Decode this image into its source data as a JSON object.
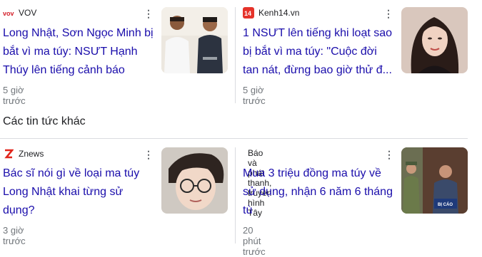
{
  "cards": [
    {
      "source": "VOV",
      "logo_icon": "vov-logo",
      "title": "Long Nhật, Sơn Ngọc Minh bị bắt vì ma túy: NSƯT Hạnh Thúy lên tiếng cảnh báo",
      "time": "5 giờ trước",
      "image": "two-men-arrest-photo"
    },
    {
      "source": "Kenh14.vn",
      "logo_icon": "kenh14-logo",
      "title": "1 NSƯT lên tiếng khi loạt sao bị bắt vì ma túy: \"Cuộc đời tan nát, đừng bao giờ thử đ...",
      "time": "5 giờ trước",
      "image": "woman-portrait-photo"
    },
    {
      "source": "Znews",
      "logo_icon": "znews-logo",
      "title": "Bác sĩ nói gì về loại ma túy Long Nhật khai từng sử dụng?",
      "time": "3 giờ trước",
      "image": "man-glasses-photo"
    },
    {
      "source": "Báo và phát thanh, truyền hình Tây",
      "logo_icon": "",
      "title": "Mua 3 triệu đồng ma túy về sử dụng, nhận 6 năm 6 tháng tù",
      "time": "20 phút trước",
      "image": "courtroom-photo",
      "image_label": "BỊ CÁO"
    }
  ],
  "section_title": "Các tin tức khác",
  "colors": {
    "link": "#1a0dab",
    "meta": "#70757a",
    "divider": "#dadce0",
    "vov_red": "#d4202a",
    "kenh14_red": "#e5332a",
    "znews_red": "#e1251b"
  }
}
